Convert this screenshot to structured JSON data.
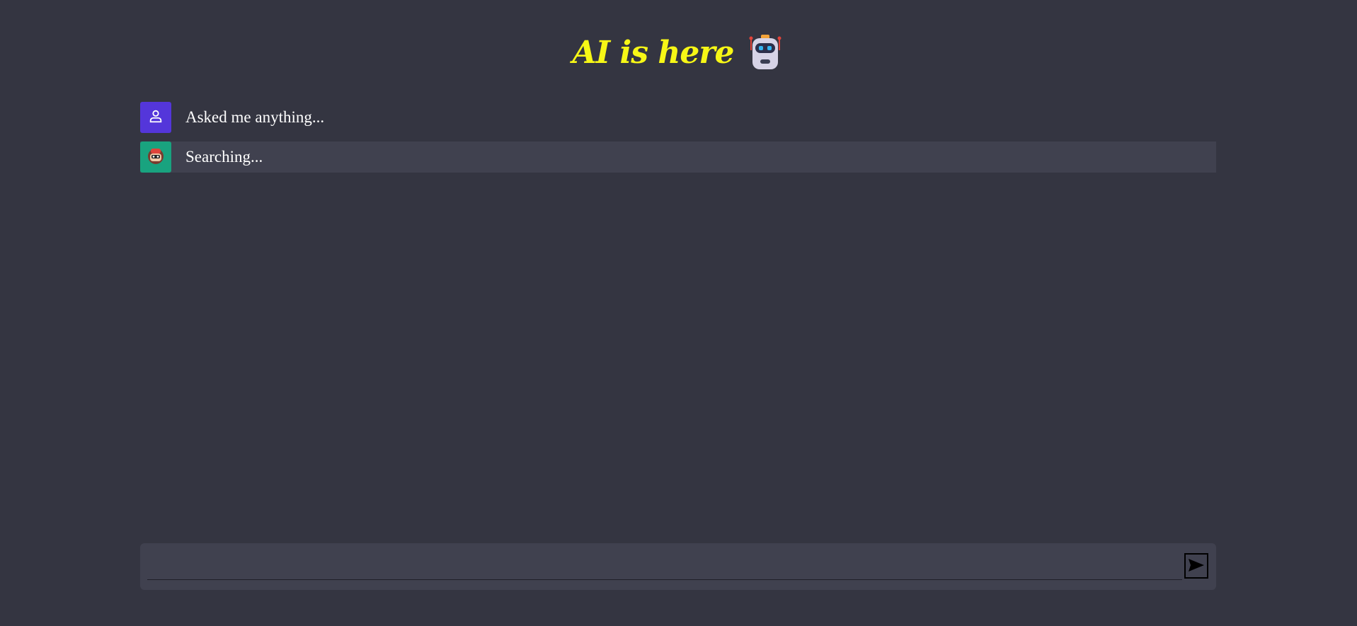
{
  "header": {
    "title": "AI is here",
    "title_color": "#f7f716",
    "icon": "robot-icon"
  },
  "messages": [
    {
      "role": "user",
      "avatar_icon": "user-icon",
      "text": "Asked me anything..."
    },
    {
      "role": "bot",
      "avatar_icon": "bot-avatar-icon",
      "text": "Searching..."
    }
  ],
  "composer": {
    "input_value": "",
    "input_placeholder": "",
    "send_icon": "send-icon"
  },
  "colors": {
    "background": "#343541",
    "panel": "#40414f",
    "user_avatar": "#5436da",
    "bot_avatar": "#19a37f"
  }
}
